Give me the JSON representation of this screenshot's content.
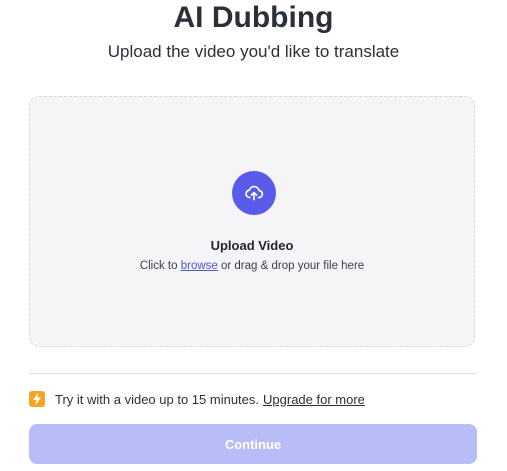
{
  "header": {
    "title": "AI Dubbing",
    "subtitle": "Upload the video you'd like to translate"
  },
  "dropzone": {
    "icon": "cloud-upload-icon",
    "heading": "Upload Video",
    "hint_prefix": "Click to ",
    "browse_label": "browse",
    "hint_suffix": " or drag & drop your file here"
  },
  "notice": {
    "icon": "lightning-bolt-icon",
    "text": "Try it with a video up to 15 minutes.",
    "upgrade_label": "Upgrade for more"
  },
  "actions": {
    "continue_label": "Continue"
  },
  "colors": {
    "accent": "#5b5bea",
    "button_disabled": "#b9bdf7",
    "warning": "#f5a524",
    "dropzone_bg": "#f5f5f7"
  }
}
